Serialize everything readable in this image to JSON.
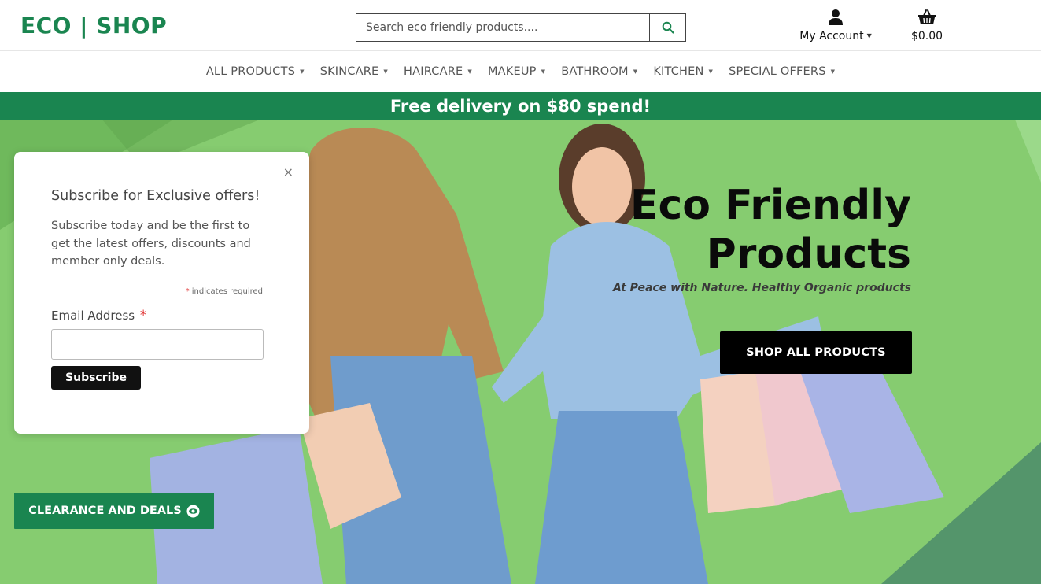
{
  "header": {
    "logo": "ECO | SHOP",
    "search_placeholder": "Search eco friendly products....",
    "account_label": "My Account",
    "cart_total": "$0.00"
  },
  "nav": {
    "items": [
      {
        "label": "ALL PRODUCTS"
      },
      {
        "label": "SKINCARE"
      },
      {
        "label": "HAIRCARE"
      },
      {
        "label": "MAKEUP"
      },
      {
        "label": "BATHROOM"
      },
      {
        "label": "KITCHEN"
      },
      {
        "label": "SPECIAL OFFERS"
      }
    ]
  },
  "banner": {
    "text": "Free delivery on $80 spend!"
  },
  "hero": {
    "title_line1": "Eco Friendly",
    "title_line2": "Products",
    "subtitle": "At Peace with Nature. Healthy Organic products",
    "shop_button": "SHOP ALL PRODUCTS",
    "clearance_button": "CLEARANCE AND DEALS"
  },
  "popup": {
    "close": "×",
    "title": "Subscribe for Exclusive offers!",
    "text": "Subscribe today and be the first to get the latest offers, discounts and member only deals.",
    "required_star": "*",
    "required_note": "indicates required",
    "email_label": "Email Address",
    "email_value": "",
    "subscribe_button": "Subscribe"
  },
  "colors": {
    "brand_green": "#1a8550",
    "hero_green": "#7fc96a",
    "button_black": "#000000",
    "required_red": "#e03333"
  },
  "icons": {
    "search": "search-icon",
    "account": "user-icon",
    "cart": "basket-icon",
    "caret": "caret-down-icon",
    "clearance": "eye-icon",
    "close": "close-icon"
  }
}
